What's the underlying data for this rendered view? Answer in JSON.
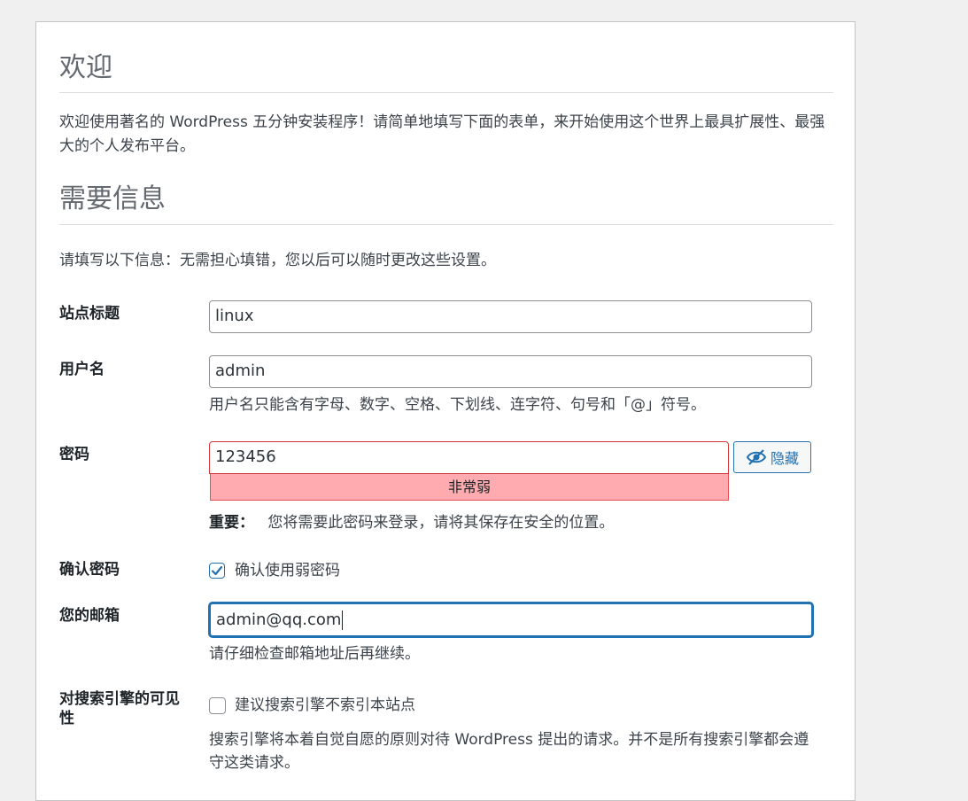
{
  "welcome": {
    "title": "欢迎",
    "intro": "欢迎使用著名的 WordPress 五分钟安装程序！请简单地填写下面的表单，来开始使用这个世界上最具扩展性、最强大的个人发布平台。"
  },
  "info": {
    "title": "需要信息",
    "subtitle": "请填写以下信息：无需担心填错，您以后可以随时更改这些设置。"
  },
  "site_title": {
    "label": "站点标题",
    "value": "linux"
  },
  "username": {
    "label": "用户名",
    "value": "admin",
    "hint": "用户名只能含有字母、数字、空格、下划线、连字符、句号和「@」符号。"
  },
  "password": {
    "label": "密码",
    "value": "123456",
    "strength": "非常弱",
    "hide_button": "隐藏",
    "hide_icon": "eye-slash-icon",
    "important_label": "重要：",
    "important_text": "您将需要此密码来登录，请将其保存在安全的位置。"
  },
  "confirm_password": {
    "label": "确认密码",
    "checkbox_label": "确认使用弱密码",
    "checked": true
  },
  "email": {
    "label": "您的邮箱",
    "value": "admin@qq.com",
    "hint": "请仔细检查邮箱地址后再继续。"
  },
  "search_visibility": {
    "label": "对搜索引擎的可见性",
    "checkbox_label": "建议搜索引擎不索引本站点",
    "checked": false,
    "hint": "搜索引擎将本着自觉自愿的原则对待 WordPress 提出的请求。并不是所有搜索引擎都会遵守这类请求。"
  },
  "colors": {
    "accent": "#2271b1",
    "error": "#d63638",
    "weak_strength_bg": "#ffabaf"
  }
}
